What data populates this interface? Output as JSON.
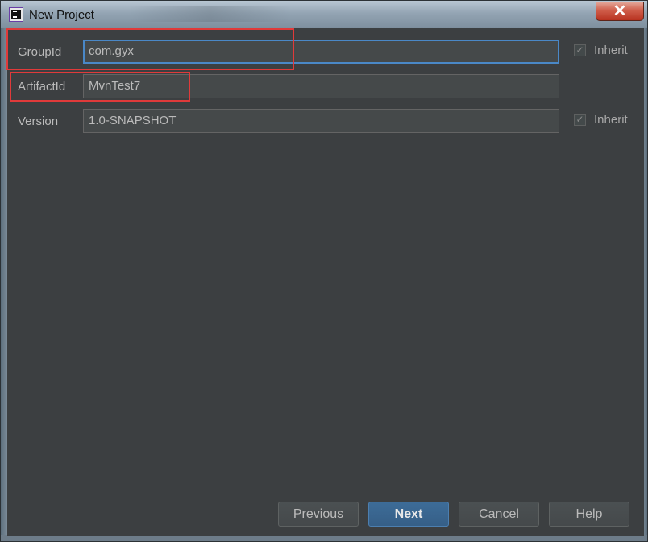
{
  "window": {
    "title": "New Project",
    "close_glyph": "✕"
  },
  "form": {
    "group_id": {
      "label": "GroupId",
      "value": "com.gyx",
      "inherit_label": "Inherit",
      "inherit_checked": true
    },
    "artifact_id": {
      "label": "ArtifactId",
      "value": "MvnTest7"
    },
    "version": {
      "label": "Version",
      "value": "1.0-SNAPSHOT",
      "inherit_label": "Inherit",
      "inherit_checked": true
    }
  },
  "buttons": {
    "previous": {
      "label_mnemonic": "P",
      "label_rest": "revious"
    },
    "next": {
      "label_mnemonic": "N",
      "label_rest": "ext"
    },
    "cancel": "Cancel",
    "help": "Help"
  },
  "colors": {
    "background": "#3c3f41",
    "focus_border": "#4a88c7",
    "annotation": "#e03a3a",
    "primary_button": "#365f87"
  },
  "icons": {
    "app": "intellij-idea-icon",
    "checkbox": "checkmark-icon"
  }
}
